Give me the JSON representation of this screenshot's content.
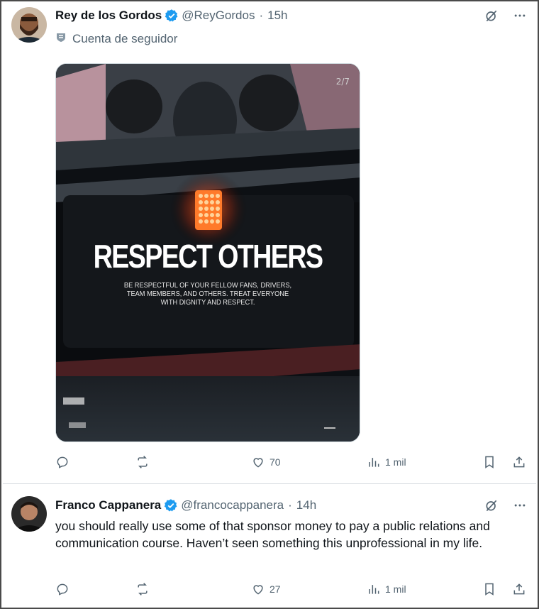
{
  "tweets": [
    {
      "name": "Rey de los Gordos",
      "handle": "@ReyGordos",
      "time": "15h",
      "subtext": "Cuenta de seguidor",
      "media": {
        "counter": "2/7",
        "headline": "RESPECT OTHERS",
        "body": "BE RESPECTFUL OF YOUR FELLOW FANS, DRIVERS, TEAM MEMBERS, AND OTHERS. TREAT EVERYONE WITH DIGNITY AND RESPECT."
      },
      "actions": {
        "likes": "70",
        "views": "1 mil"
      }
    },
    {
      "name": "Franco Cappanera",
      "handle": "@francocappanera",
      "time": "14h",
      "text": "you should really use some of that sponsor money to pay a public relations and communication course. Haven’t seen something this unprofessional in my life.",
      "actions": {
        "likes": "27",
        "views": "1 mil"
      }
    }
  ],
  "colors": {
    "verified": "#1d9bf0",
    "muted": "#536471",
    "text": "#0f1419"
  },
  "icons": [
    "reply-icon",
    "retweet-icon",
    "like-icon",
    "views-icon",
    "bookmark-icon",
    "share-icon",
    "grok-icon",
    "more-icon",
    "supporter-badge-icon",
    "verified-icon"
  ]
}
